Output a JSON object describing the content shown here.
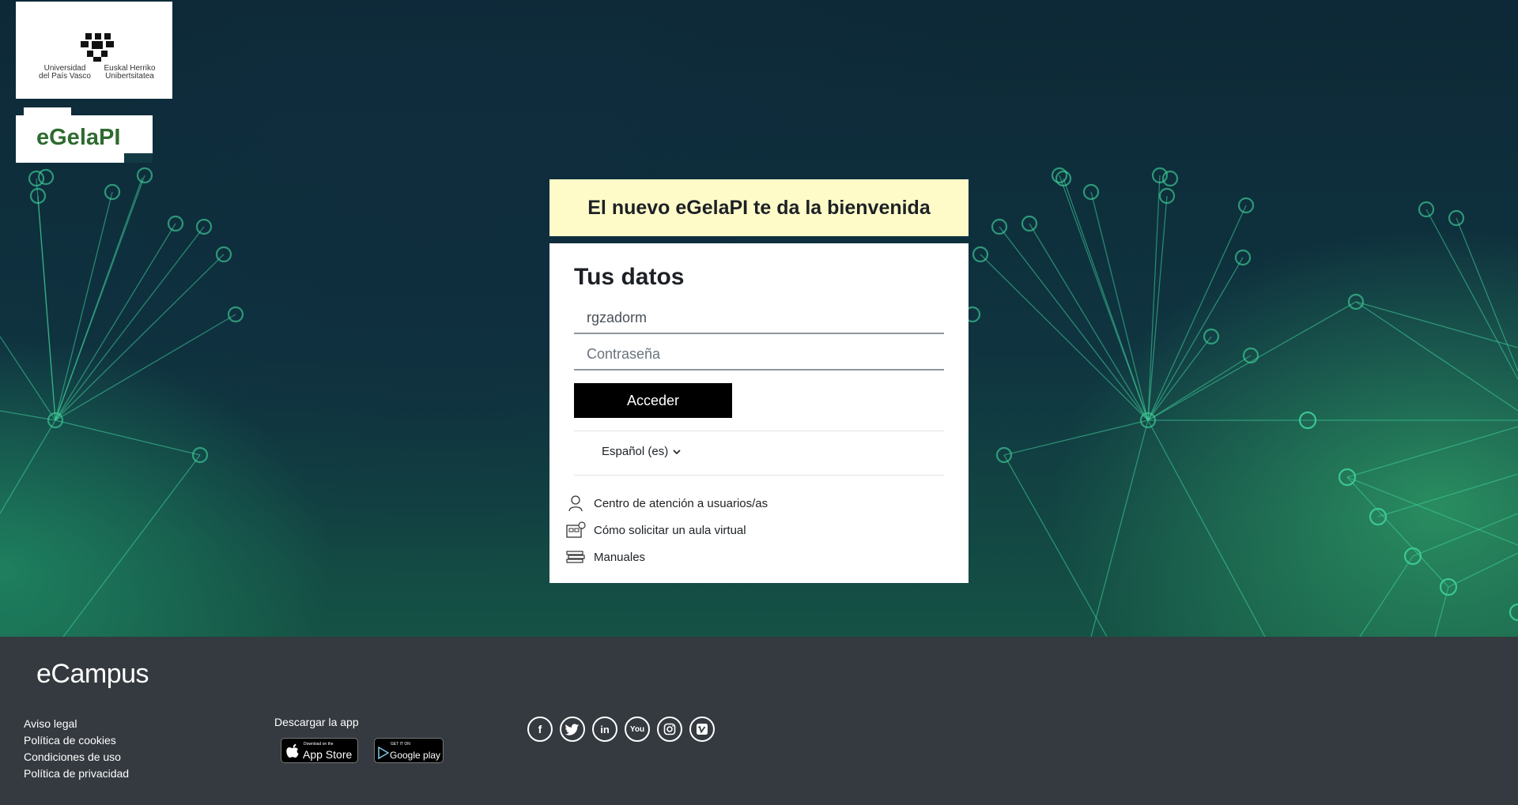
{
  "branding": {
    "university_left": "Universidad\ndel País Vasco",
    "university_right": "Euskal Herriko\nUnibertsitatea",
    "product_name": "eGelaPI"
  },
  "login": {
    "welcome": "El nuevo eGelaPI te da la bienvenida",
    "heading": "Tus datos",
    "username_value": "rgzadorm",
    "password_placeholder": "Contraseña",
    "submit_label": "Acceder",
    "language": "Español (es)"
  },
  "help_links": [
    {
      "label": "Centro de atención a usuarios/as",
      "icon": "user-support-icon"
    },
    {
      "label": "Cómo solicitar un aula virtual",
      "icon": "virtual-classroom-icon"
    },
    {
      "label": "Manuales",
      "icon": "manuals-icon"
    }
  ],
  "footer": {
    "brand": "eCampus",
    "links": [
      "Aviso legal",
      "Política de cookies",
      "Condiciones de uso",
      "Política de privacidad"
    ],
    "download_label": "Descargar la app",
    "app_store_small": "Download on the",
    "app_store": "App Store",
    "google_play_small": "GET IT ON",
    "google_play": "Google play",
    "social": [
      "facebook-icon",
      "twitter-icon",
      "linkedin-icon",
      "youtube-icon",
      "instagram-icon",
      "vimeo-icon"
    ]
  },
  "colors": {
    "welcome_bg": "#fffbc9",
    "footer_bg": "#343a40",
    "egela_green": "#2e6b2f",
    "button_bg": "#000000"
  }
}
